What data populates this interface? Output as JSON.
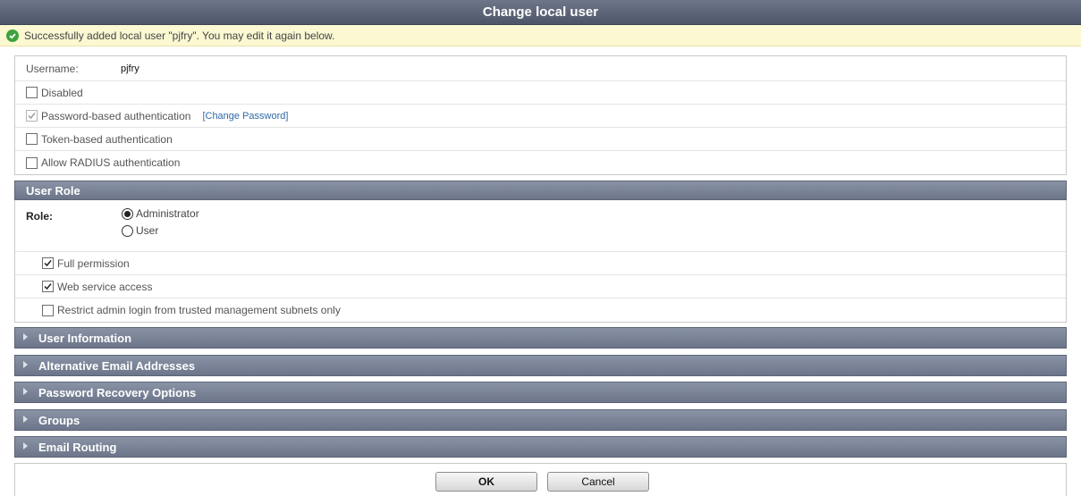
{
  "dialog": {
    "title": "Change local user"
  },
  "notice": {
    "message": "Successfully added local user \"pjfry\". You may edit it again below.",
    "icon": "check-circle-icon",
    "color": "#3da33d"
  },
  "account": {
    "username_label": "Username:",
    "username_value": "pjfry",
    "disabled_label": "Disabled",
    "password_auth_label": "Password-based authentication",
    "change_password_link": "[Change Password]",
    "token_auth_label": "Token-based authentication",
    "radius_auth_label": "Allow RADIUS authentication"
  },
  "user_role": {
    "header": "User Role",
    "role_label": "Role:",
    "options": [
      "Administrator",
      "User"
    ],
    "selected": "Administrator",
    "full_permission_label": "Full permission",
    "web_service_label": "Web service access",
    "restrict_login_label": "Restrict admin login from trusted management subnets only"
  },
  "sections": [
    "User Information",
    "Alternative Email Addresses",
    "Password Recovery Options",
    "Groups",
    "Email Routing"
  ],
  "buttons": {
    "ok": "OK",
    "cancel": "Cancel"
  }
}
